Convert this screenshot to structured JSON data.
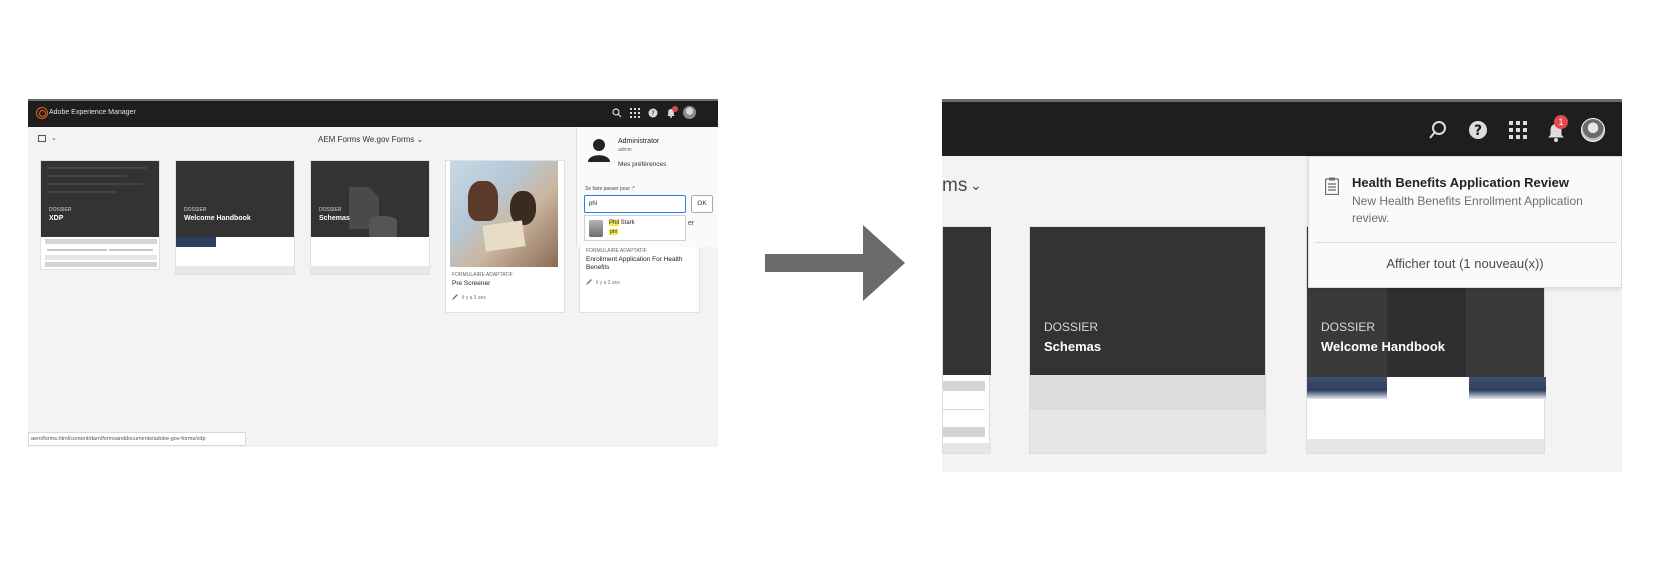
{
  "left": {
    "app_title": "Adobe Experience Manager",
    "breadcrumb": "AEM Forms We.gov Forms",
    "notification_count": "1",
    "cards": [
      {
        "kind": "DOSSIER",
        "title": "XDP"
      },
      {
        "kind": "DOSSIER",
        "title": "Welcome Handbook"
      },
      {
        "kind": "DOSSIER",
        "title": "Schemas"
      }
    ],
    "form_cards": [
      {
        "kind": "FORMULAIRE ADAPTATIF",
        "title": "Pre Screener",
        "time": "il y a 3 ans"
      },
      {
        "kind": "FORMULAIRE ADAPTATIF",
        "title": "Enrollment Application For Health Benefits",
        "time": "il y a 3 ans"
      }
    ],
    "user_panel": {
      "name": "Administrator",
      "id": "admin",
      "preferences": "Mes préférences",
      "impersonate_label": "Se faire passer pour :*",
      "input_value": "phi",
      "ok_label": "OK",
      "suggestion_name_highlight": "Phil",
      "suggestion_name_rest": " Stark",
      "suggestion_id": "phi",
      "cut_text": "er"
    },
    "status_url": "aem/forms.html/content/dam/formsanddocuments/adobe-gov-forms/xdp"
  },
  "right": {
    "breadcrumb_fragment": "ms",
    "notification_count": "1",
    "cards": [
      {
        "kind": "DOSSIER",
        "title": "Schemas"
      },
      {
        "kind": "DOSSIER",
        "title": "Welcome Handbook"
      }
    ],
    "notification": {
      "title": "Health Benefits Application Review",
      "body": "New Health Benefits Enrollment Application review.",
      "view_all": "Afficher tout (1 nouveau(x))"
    }
  },
  "colors": {
    "topbar": "#1e1e1e",
    "accent_blue": "#2680eb",
    "badge_red": "#e34850",
    "highlight_yellow": "#f7e94a",
    "aem_orange": "#e8641e"
  }
}
